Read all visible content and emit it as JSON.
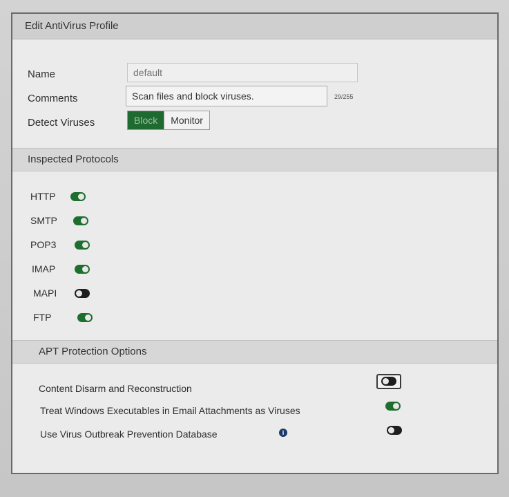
{
  "dialog": {
    "title": "Edit AntiVirus Profile"
  },
  "form": {
    "name_label": "Name",
    "name_placeholder": "default",
    "comments_label": "Comments",
    "comments_value": "Scan files and block viruses.",
    "comments_counter": "29/255",
    "detect_label": "Detect Viruses",
    "detect_options": [
      "Block",
      "Monitor"
    ],
    "detect_selected": "Block"
  },
  "inspected_protocols": {
    "header": "Inspected Protocols",
    "items": [
      {
        "label": "HTTP",
        "enabled": true
      },
      {
        "label": "SMTP",
        "enabled": true
      },
      {
        "label": "POP3",
        "enabled": true
      },
      {
        "label": "IMAP",
        "enabled": true
      },
      {
        "label": "MAPI",
        "enabled": false
      },
      {
        "label": "FTP",
        "enabled": true
      }
    ]
  },
  "apt_options": {
    "header": "APT Protection Options",
    "items": [
      {
        "label": "Content Disarm and Reconstruction",
        "enabled": false
      },
      {
        "label": "Treat Windows Executables in Email Attachments as Viruses",
        "enabled": true
      },
      {
        "label": "Use Virus Outbreak Prevention Database",
        "enabled": false,
        "info_icon": "info-icon"
      }
    ]
  },
  "colors": {
    "toggle_on": "#1e6e2e",
    "toggle_off": "#1e1e1e",
    "active_button": "#1e6a30"
  }
}
